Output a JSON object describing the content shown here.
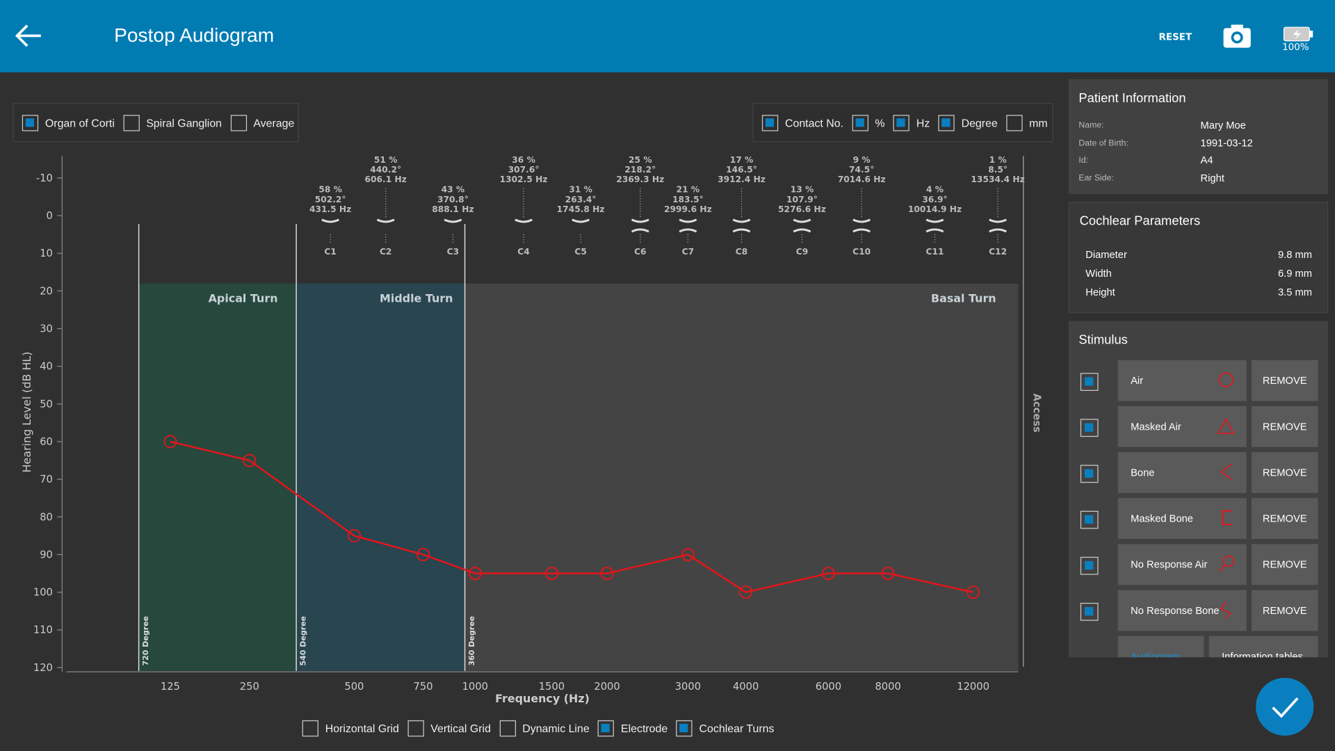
{
  "header": {
    "title": "Postop Audiogram",
    "reset_label": "RESET",
    "battery": "100%",
    "color": "#007cb3"
  },
  "top_left_options": [
    {
      "label": "Organ of Corti",
      "checked": true
    },
    {
      "label": "Spiral Ganglion",
      "checked": false
    },
    {
      "label": "Average",
      "checked": false
    }
  ],
  "top_right_options": [
    {
      "label": "Contact No.",
      "checked": true
    },
    {
      "label": "%",
      "checked": true
    },
    {
      "label": "Hz",
      "checked": true
    },
    {
      "label": "Degree",
      "checked": true
    },
    {
      "label": "mm",
      "checked": false
    }
  ],
  "bottom_options": [
    {
      "label": "Horizontal Grid",
      "checked": false
    },
    {
      "label": "Vertical Grid",
      "checked": false
    },
    {
      "label": "Dynamic Line",
      "checked": false
    },
    {
      "label": "Electrode",
      "checked": true
    },
    {
      "label": "Cochlear Turns",
      "checked": true
    }
  ],
  "chart_data": {
    "type": "line",
    "xlabel": "Frequency (Hz)",
    "ylabel": "Hearing Level (dB HL)",
    "x_ticks": [
      "125",
      "250",
      "500",
      "750",
      "1000",
      "1500",
      "2000",
      "3000",
      "4000",
      "6000",
      "8000",
      "12000"
    ],
    "y_ticks": [
      "-10",
      "0",
      "10",
      "20",
      "30",
      "40",
      "50",
      "60",
      "70",
      "80",
      "90",
      "100",
      "110",
      "120"
    ],
    "ylim": [
      -10,
      120
    ],
    "y_inverted": true,
    "series": [
      {
        "marker": "circle",
        "color": "#e8141a",
        "x": [
          125,
          250,
          500,
          750,
          1000,
          1500,
          2000,
          3000,
          4000,
          6000,
          8000,
          12000
        ],
        "y": [
          60,
          65,
          85,
          90,
          95,
          95,
          95,
          90,
          100,
          95,
          95,
          100
        ]
      }
    ],
    "turns": [
      {
        "label": "Apical Turn",
        "color": "#27483d"
      },
      {
        "label": "Middle Turn",
        "color": "#284550"
      },
      {
        "label": "Basal Turn",
        "color": "#444444"
      }
    ],
    "degree_lines": [
      "720 Degree",
      "540 Degree",
      "360 Degree"
    ],
    "side_label": "Access",
    "electrodes": [
      {
        "id": "C1",
        "pct": "58 %",
        "deg": "502.2°",
        "hz": "431.5 Hz"
      },
      {
        "id": "C2",
        "pct": "51 %",
        "deg": "440.2°",
        "hz": "606.1 Hz"
      },
      {
        "id": "C3",
        "pct": "43 %",
        "deg": "370.8°",
        "hz": "888.1 Hz"
      },
      {
        "id": "C4",
        "pct": "36 %",
        "deg": "307.6°",
        "hz": "1302.5 Hz"
      },
      {
        "id": "C5",
        "pct": "31 %",
        "deg": "263.4°",
        "hz": "1745.8 Hz"
      },
      {
        "id": "C6",
        "pct": "25 %",
        "deg": "218.2°",
        "hz": "2369.3 Hz"
      },
      {
        "id": "C7",
        "pct": "21 %",
        "deg": "183.5°",
        "hz": "2999.6 Hz"
      },
      {
        "id": "C8",
        "pct": "17 %",
        "deg": "146.5°",
        "hz": "3912.4 Hz"
      },
      {
        "id": "C9",
        "pct": "13 %",
        "deg": "107.9°",
        "hz": "5276.6 Hz"
      },
      {
        "id": "C10",
        "pct": "9 %",
        "deg": "74.5°",
        "hz": "7014.6 Hz"
      },
      {
        "id": "C11",
        "pct": "4 %",
        "deg": "36.9°",
        "hz": "10014.9 Hz"
      },
      {
        "id": "C12",
        "pct": "1 %",
        "deg": "8.5°",
        "hz": "13534.4 Hz"
      }
    ]
  },
  "patient": {
    "title": "Patient Information",
    "rows": [
      {
        "label": "Name:",
        "value": "Mary Moe"
      },
      {
        "label": "Date of Birth:",
        "value": "1991-03-12"
      },
      {
        "label": "Id:",
        "value": "A4"
      },
      {
        "label": "Ear Side:",
        "value": "Right"
      }
    ]
  },
  "cochlear": {
    "title": "Cochlear Parameters",
    "rows": [
      {
        "label": "Diameter",
        "value": "9.8 mm"
      },
      {
        "label": "Width",
        "value": "6.9 mm"
      },
      {
        "label": "Height",
        "value": "3.5 mm"
      }
    ]
  },
  "stimulus": {
    "title": "Stimulus",
    "remove_label": "REMOVE",
    "items": [
      {
        "label": "Air",
        "icon": "circle"
      },
      {
        "label": "Masked Air",
        "icon": "triangle"
      },
      {
        "label": "Bone",
        "icon": "less-than"
      },
      {
        "label": "Masked Bone",
        "icon": "bracket"
      },
      {
        "label": "No Response Air",
        "icon": "circle-arrow"
      },
      {
        "label": "No Response Bone",
        "icon": "zigzag"
      }
    ],
    "tabs": [
      "Audiogram",
      "Information tables"
    ]
  }
}
